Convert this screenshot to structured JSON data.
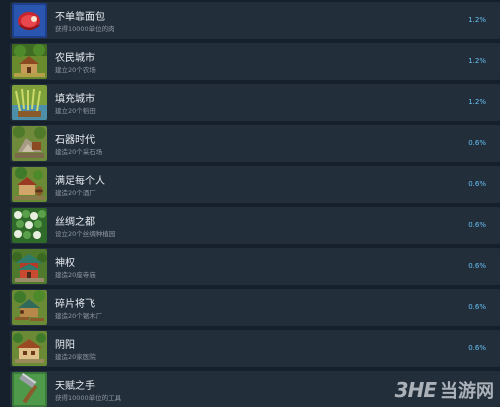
{
  "achievements": [
    {
      "title": "不单靠面包",
      "desc": "获得10000单位的肉",
      "pct": "1.2%",
      "icon": "meat-icon"
    },
    {
      "title": "农民城市",
      "desc": "建立20个农场",
      "pct": "1.2%",
      "icon": "farm-icon"
    },
    {
      "title": "填充城市",
      "desc": "建立20个稻田",
      "pct": "1.2%",
      "icon": "rice-field-icon"
    },
    {
      "title": "石器时代",
      "desc": "建造20个采石场",
      "pct": "0.6%",
      "icon": "quarry-icon"
    },
    {
      "title": "满足每个人",
      "desc": "建造20个酒厂",
      "pct": "0.6%",
      "icon": "brewery-icon"
    },
    {
      "title": "丝绸之都",
      "desc": "设立20个丝绸种植园",
      "pct": "0.6%",
      "icon": "silk-plantation-icon"
    },
    {
      "title": "神权",
      "desc": "建造20座寺庙",
      "pct": "0.6%",
      "icon": "temple-icon"
    },
    {
      "title": "碎片将飞",
      "desc": "建造20个锯木厂",
      "pct": "0.6%",
      "icon": "sawmill-icon"
    },
    {
      "title": "阴阳",
      "desc": "建造20家医院",
      "pct": "0.6%",
      "icon": "hospital-icon"
    },
    {
      "title": "天赋之手",
      "desc": "获得10000单位的工具",
      "pct": "",
      "icon": "tool-icon"
    }
  ],
  "watermark": {
    "logo": "3HE",
    "text": "当游网"
  }
}
